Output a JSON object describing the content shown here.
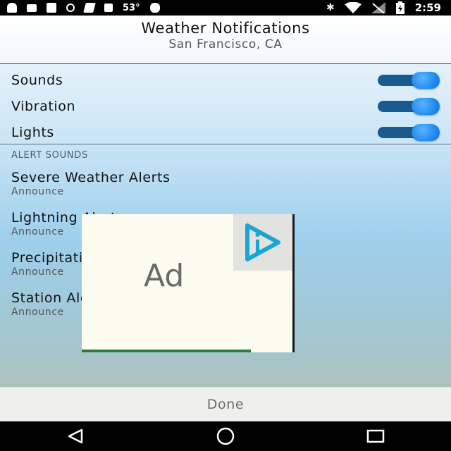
{
  "status_bar": {
    "temperature": "53°",
    "time": "2:59",
    "left_icons": [
      "android-icon",
      "message-icon",
      "facebook-icon",
      "data-saver-icon",
      "flag-icon",
      "lock-icon"
    ],
    "right_icons": [
      "bluetooth-icon",
      "wifi-icon",
      "signal-icon",
      "battery-icon"
    ]
  },
  "header": {
    "title": "Weather Notifications",
    "subtitle": "San Francisco, CA"
  },
  "toggles": [
    {
      "label": "Sounds",
      "on": true
    },
    {
      "label": "Vibration",
      "on": true
    },
    {
      "label": "Lights",
      "on": true
    }
  ],
  "alert_section": {
    "heading": "ALERT SOUNDS",
    "items": [
      {
        "name": "Severe Weather Alerts",
        "sound": "Announce"
      },
      {
        "name": "Lightning Alerts",
        "sound": "Announce"
      },
      {
        "name": "Precipitation Alerts",
        "sound": "Announce"
      },
      {
        "name": "Station Alerts",
        "sound": "Announce"
      }
    ]
  },
  "ad": {
    "label": "Ad",
    "accent_color": "#19a6d6"
  },
  "footer": {
    "done_label": "Done"
  },
  "colors": {
    "toggle_track": "#1b5a8f",
    "toggle_thumb": "#1a86ea"
  },
  "nav": [
    "back-icon",
    "home-icon",
    "recents-icon"
  ]
}
